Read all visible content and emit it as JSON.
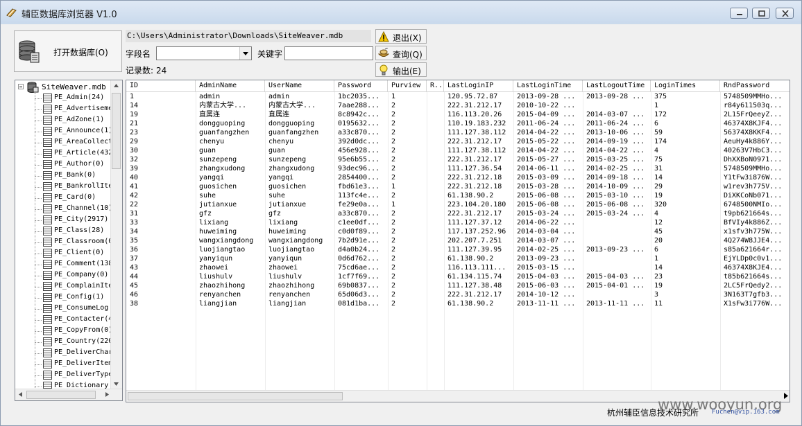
{
  "window": {
    "title": "辅臣数据库浏览器 V1.0"
  },
  "toolbar": {
    "open_label": "打开数据库(O)",
    "path": "C:\\Users\\Administrator\\Downloads\\SiteWeaver.mdb",
    "field_label": "字段名",
    "field_value": "",
    "keyword_label": "关键字",
    "keyword_value": "",
    "count_label": "记录数:",
    "count_value": "24",
    "exit_label": "退出(X)",
    "query_label": "查询(Q)",
    "export_label": "输出(E)"
  },
  "tree": {
    "root": "SiteWeaver.mdb",
    "items": [
      "PE_Admin(24)",
      "PE_Advertiseme",
      "PE_AdZone(1)",
      "PE_Announce(1)",
      "PE_AreaCollect",
      "PE_Article(432",
      "PE_Author(0)",
      "PE_Bank(0)",
      "PE_BankrollIte",
      "PE_Card(0)",
      "PE_Channel(10)",
      "PE_City(2917)",
      "PE_Class(28)",
      "PE_Classroom(0",
      "PE_Client(0)",
      "PE_Comment(138",
      "PE_Company(0)",
      "PE_ComplainIte",
      "PE_Config(1)",
      "PE_ConsumeLog",
      "PE_Contacter(4",
      "PE_CopyFrom(0)",
      "PE_Country(220",
      "PE_DeliverChar",
      "PE_DeliverItem",
      "PE_DeliverType",
      "PE_Dictionary"
    ]
  },
  "grid": {
    "columns": [
      "ID",
      "AdminName",
      "UserName",
      "Password",
      "Purview",
      "R..",
      "LastLoginIP",
      "LastLoginTime",
      "LastLogoutTime",
      "LoginTimes",
      "RndPassword"
    ],
    "rows": [
      [
        "1",
        "admin",
        "admin",
        "1bc2035...",
        "1",
        "",
        "120.95.72.87",
        "2013-09-28 ...",
        "2013-09-28 ...",
        "375",
        "5748509MMHo..."
      ],
      [
        "14",
        "内蒙古大学...",
        "内蒙古大学...",
        "7aae288...",
        "2",
        "",
        "222.31.212.17",
        "2010-10-22 ...",
        "",
        "1",
        "r84y611503q..."
      ],
      [
        "19",
        "直属连",
        "直属连",
        "8c8942c...",
        "2",
        "",
        "116.113.20.26",
        "2015-04-09 ...",
        "2014-03-07 ...",
        "172",
        "2L15FrQeeyZ..."
      ],
      [
        "21",
        "dongguoping",
        "dongguoping",
        "0195632...",
        "2",
        "",
        "110.19.183.232",
        "2011-06-24 ...",
        "2011-06-24 ...",
        "6",
        "46374X8KJF4..."
      ],
      [
        "23",
        "guanfangzhen",
        "guanfangzhen",
        "a33c870...",
        "2",
        "",
        "111.127.38.112",
        "2014-04-22 ...",
        "2013-10-06 ...",
        "59",
        "56374X8KKF4..."
      ],
      [
        "29",
        "chenyu",
        "chenyu",
        "392d0dc...",
        "2",
        "",
        "222.31.212.17",
        "2015-05-22 ...",
        "2014-09-19 ...",
        "174",
        "AeuHy4k886Y..."
      ],
      [
        "30",
        "guan",
        "guan",
        "456e928...",
        "2",
        "",
        "111.127.38.112",
        "2014-04-22 ...",
        "2014-04-22 ...",
        "4",
        "40263V7HbC3..."
      ],
      [
        "32",
        "sunzepeng",
        "sunzepeng",
        "95e6b55...",
        "2",
        "",
        "222.31.212.17",
        "2015-05-27 ...",
        "2015-03-25 ...",
        "75",
        "DhXXBoN0971..."
      ],
      [
        "39",
        "zhangxudong",
        "zhangxudong",
        "93dec96...",
        "2",
        "",
        "111.127.36.54",
        "2014-06-11 ...",
        "2014-02-25 ...",
        "31",
        "5748509MMHo..."
      ],
      [
        "40",
        "yangqi",
        "yangqi",
        "2854400...",
        "2",
        "",
        "222.31.212.18",
        "2015-03-09 ...",
        "2014-09-18 ...",
        "14",
        "Y1tFw3i876W..."
      ],
      [
        "41",
        "guosichen",
        "guosichen",
        "fbd61e3...",
        "1",
        "",
        "222.31.212.18",
        "2015-03-28 ...",
        "2014-10-09 ...",
        "29",
        "w1rev3h775V..."
      ],
      [
        "42",
        "suhe",
        "suhe",
        "113fc4e...",
        "2",
        "",
        "61.138.90.2",
        "2015-06-08 ...",
        "2015-03-10 ...",
        "19",
        "DiXKCoNb071..."
      ],
      [
        "22",
        "jutianxue",
        "jutianxue",
        "fe29e0a...",
        "1",
        "",
        "223.104.20.180",
        "2015-06-08 ...",
        "2015-06-08 ...",
        "320",
        "6748500NMIo..."
      ],
      [
        "31",
        "gfz",
        "gfz",
        "a33c870...",
        "2",
        "",
        "222.31.212.17",
        "2015-03-24 ...",
        "2015-03-24 ...",
        "4",
        "t9pb621664s..."
      ],
      [
        "33",
        "lixiang",
        "lixiang",
        "c1ee0df...",
        "2",
        "",
        "111.127.37.12",
        "2014-06-22 ...",
        "",
        "12",
        "BfVIy4k886Z..."
      ],
      [
        "34",
        "huweiming",
        "huweiming",
        "c0d0f89...",
        "2",
        "",
        "117.137.252.96",
        "2014-03-04 ...",
        "",
        "45",
        "x1sfv3h775W..."
      ],
      [
        "35",
        "wangxiangdong",
        "wangxiangdong",
        "7b2d91e...",
        "2",
        "",
        "202.207.7.251",
        "2014-03-07 ...",
        "",
        "20",
        "4Q274W8JJE4..."
      ],
      [
        "36",
        "luojiangtao",
        "luojiangtao",
        "d4a0b24...",
        "2",
        "",
        "111.127.39.95",
        "2014-02-25 ...",
        "2013-09-23 ...",
        "6",
        "s85a621664r..."
      ],
      [
        "37",
        "yanyiqun",
        "yanyiqun",
        "0d6d762...",
        "2",
        "",
        "61.138.90.2",
        "2013-09-23 ...",
        "",
        "1",
        "EjYLDp0c0v1..."
      ],
      [
        "43",
        "zhaowei",
        "zhaowei",
        "75cd6ae...",
        "2",
        "",
        "116.113.111...",
        "2015-03-15 ...",
        "",
        "14",
        "46374X8KJE4..."
      ],
      [
        "44",
        "liushulv",
        "liushulv",
        "1cf7f69...",
        "2",
        "",
        "61.134.115.74",
        "2015-04-03 ...",
        "2015-04-03 ...",
        "23",
        "t85b621664s..."
      ],
      [
        "45",
        "zhaozhihong",
        "zhaozhihong",
        "69b0837...",
        "2",
        "",
        "111.127.38.48",
        "2015-06-03 ...",
        "2015-04-01 ...",
        "19",
        "2LC5FrQedy2..."
      ],
      [
        "46",
        "renyanchen",
        "renyanchen",
        "65d06d3...",
        "2",
        "",
        "222.31.212.17",
        "2014-10-12 ...",
        "",
        "3",
        "3N163T7gfb3..."
      ],
      [
        "38",
        "liangjian",
        "liangjian",
        "081d1ba...",
        "2",
        "",
        "61.138.90.2",
        "2013-11-11 ...",
        "2013-11-11 ...",
        "11",
        "X1sFw3i776W..."
      ]
    ]
  },
  "status": {
    "company": "杭州辅臣信息技术研究所"
  },
  "watermark": {
    "main": "www.wooyun.org",
    "sub": "Fuchen@vip.163.com"
  },
  "icons": {
    "app": "book-icon",
    "database": "database-icon",
    "warning": "warning-icon",
    "query": "cup-icon",
    "export": "bulb-icon"
  }
}
